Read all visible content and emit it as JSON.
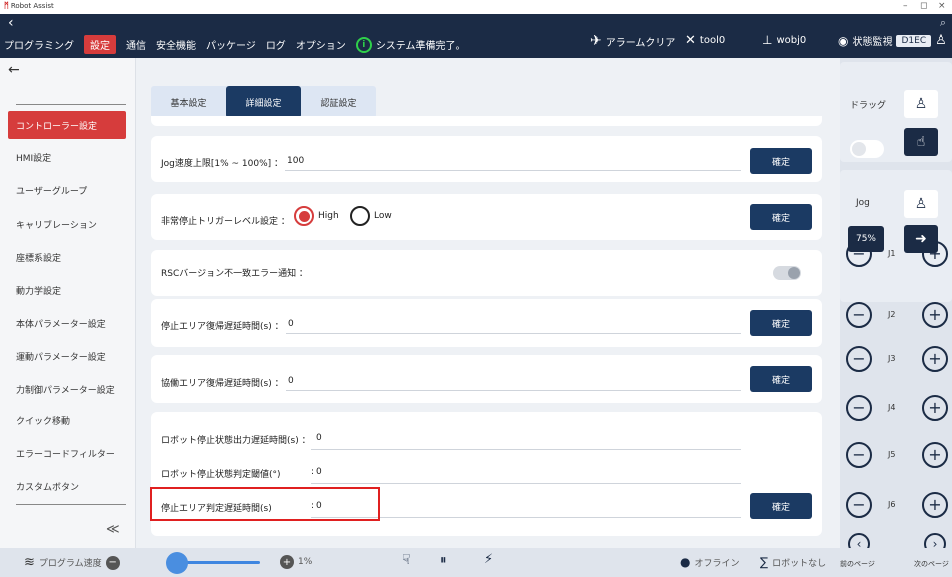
{
  "window": {
    "title": "Robot Assist",
    "controls": [
      "–",
      "◻",
      "×"
    ]
  },
  "topnav": {
    "menu": [
      "プログラミング",
      "設定",
      "通信",
      "安全機能",
      "パッケージ",
      "ログ",
      "オプション"
    ],
    "active_menu": "設定",
    "status_text": "システム準備完了。",
    "alarm_clear": "アラームクリア",
    "tool": "tool0",
    "wobj": "wobj0",
    "monitor": "状態監視",
    "monitor_badge": "D1EC"
  },
  "sidebar": {
    "items": [
      "コントローラー設定",
      "HMI設定",
      "ユーザーグループ",
      "キャリブレーション",
      "座標系設定",
      "動力学設定",
      "本体パラメーター設定",
      "運動パラメーター設定",
      "力制御パラメーター設定",
      "クイック移動",
      "エラーコードフィルター",
      "カスタムボタン"
    ],
    "active": "コントローラー設定",
    "collapse": "≪"
  },
  "tabs": {
    "items": [
      "基本設定",
      "詳細設定",
      "認証設定"
    ],
    "active": "詳細設定"
  },
  "settings": {
    "jog_label": "Jog速度上限[1% ~ 100%] ：",
    "jog_value": "100",
    "estop_label": "非常停止トリガーレベル設定 ：",
    "estop_high": "High",
    "estop_low": "Low",
    "estop_selected": "High",
    "rsc_label": "RSCバージョン不一致エラー通知 ：",
    "rsc_enabled": false,
    "stop_area_label": "停止エリア復帰遅延時間(s) ：",
    "stop_area_value": "0",
    "coop_label": "協働エリア復帰遅延時間(s) ：",
    "coop_value": "0",
    "robot_stop_out_label": "ロボット停止状態出力遅延時間(s) ：",
    "robot_stop_out_value": "0",
    "robot_stop_judge_label": "ロボット停止状態判定閾値(°)",
    "robot_stop_judge_value": "0",
    "stop_area_judge_label": "停止エリア判定遅延時間(s)",
    "stop_area_judge_value": "0",
    "confirm": "確定"
  },
  "rpanel": {
    "drag": "ドラッグ",
    "jog": "Jog",
    "speed": "75%",
    "joints": [
      "J1",
      "J2",
      "J3",
      "J4",
      "J5",
      "J6"
    ],
    "prev_page": "前のページ",
    "next_page": "次のページ"
  },
  "bottombar": {
    "program_speed": "プログラム速度",
    "speed_value": "1%",
    "offline": "オフライン",
    "no_robot": "ロボットなし"
  },
  "colors": {
    "nav": "#1b2b45",
    "accent": "#d63c3c",
    "button": "#1b3a63",
    "status_ok": "#2fd04a"
  }
}
